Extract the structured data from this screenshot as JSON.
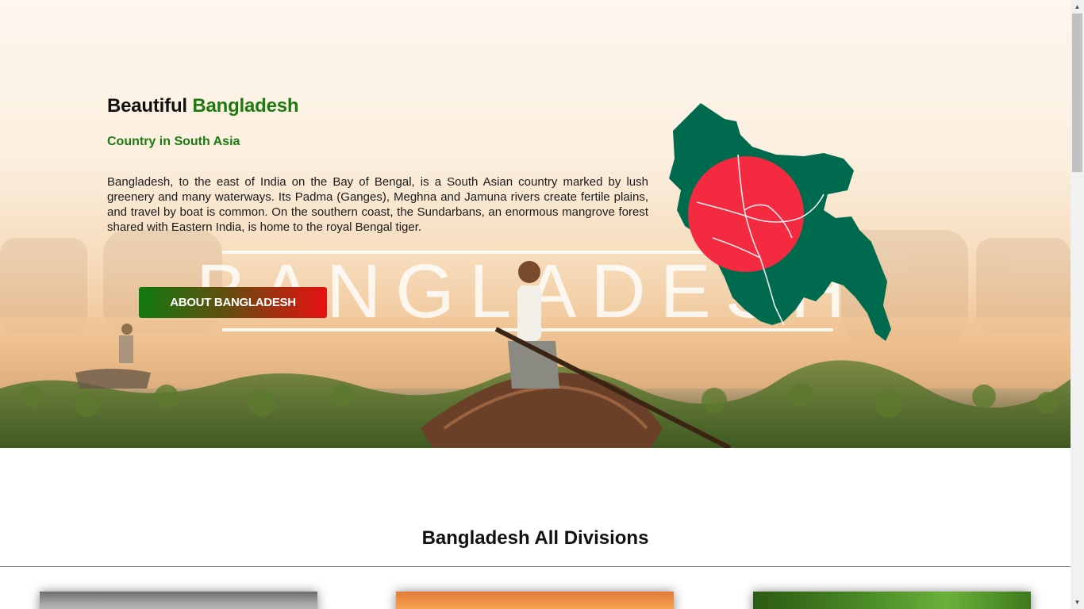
{
  "hero": {
    "title_prefix": "Beautiful",
    "title_highlight": "Bangladesh",
    "subtitle": "Country in South Asia",
    "description": "Bangladesh, to the east of India on the Bay of Bengal, is a South Asian country marked by lush greenery and many waterways. Its Padma (Ganges), Meghna and Jamuna rivers create fertile plains, and travel by boat is common. On the southern coast, the Sundarbans, an enormous mangrove forest shared with Eastern India, is home to the royal Bengal tiger.",
    "background_word": "BANGLADESH",
    "button_label": "ABOUT BANGLADESH"
  },
  "divisions": {
    "title": "Bangladesh All Divisions"
  },
  "colors": {
    "accent_green": "#1c7a10",
    "flag_green": "#006a4e",
    "flag_red": "#f42a41"
  },
  "icons": {
    "scroll_up": "▲",
    "scroll_down": "▼"
  }
}
